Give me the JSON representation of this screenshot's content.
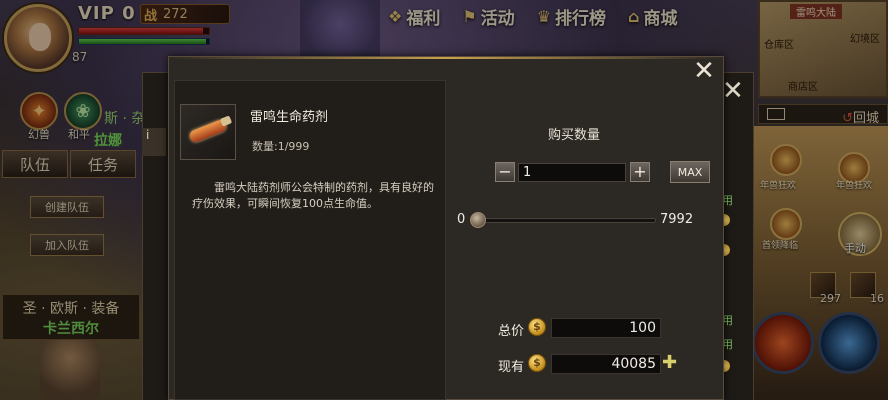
{
  "hud": {
    "vip": "VIP 0",
    "power_icon": "战",
    "power_value": "272",
    "level": "87",
    "hp_fraction": 0.95,
    "mp_fraction": 0.98,
    "skills": [
      {
        "label": "幻兽",
        "icon": "fire-beast-icon"
      },
      {
        "label": "和平",
        "icon": "peace-wreath-icon"
      }
    ],
    "npc_tag": "斯 · 杂",
    "npc_name": "拉娜",
    "tabs": [
      "队伍",
      "任务"
    ],
    "team_buttons": [
      "创建队伍",
      "加入队伍"
    ],
    "equip_banner": {
      "line1": "圣 · 欧斯 · 装备",
      "line2": "卡兰西尔"
    }
  },
  "top_menu": [
    {
      "label": "福利",
      "icon": "gift-icon"
    },
    {
      "label": "活动",
      "icon": "flag-icon"
    },
    {
      "label": "排行榜",
      "icon": "trophy-icon"
    },
    {
      "label": "商城",
      "icon": "shop-icon"
    }
  ],
  "minimap": {
    "title": "雷鸣大陆",
    "pois": [
      "仓库区",
      "幻境区",
      "商店区"
    ],
    "return_city": "回城"
  },
  "right_panel": {
    "events": [
      "年兽狂欢",
      "年兽狂欢",
      "首领降临"
    ],
    "auto_label": "手动",
    "slot_counts": [
      "297",
      "16"
    ]
  },
  "dialog": {
    "item_name": "雷鸣生命药剂",
    "item_quantity": "数量:1/999",
    "item_description": "雷鸣大陆药剂师公会特制的药剂，具有良好的疗伤效果，可瞬间恢复100点生命值。",
    "qty_title": "购买数量",
    "minus": "−",
    "plus": "+",
    "quantity_value": "1",
    "max_label": "MAX",
    "slider_min": "0",
    "slider_max": "7992",
    "total_label": "总价",
    "total_value": "100",
    "own_label": "现有",
    "own_value": "40085",
    "add_coin": "✚",
    "coin_glyph": "$",
    "close": "✕"
  }
}
